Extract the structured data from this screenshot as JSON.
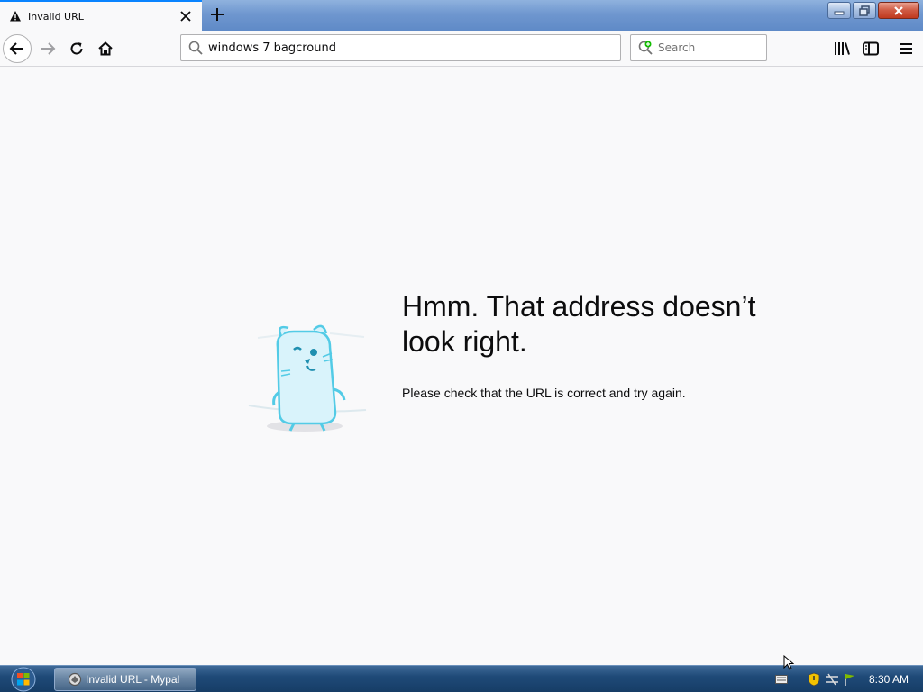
{
  "browser": {
    "tab": {
      "title": "Invalid URL",
      "icon": "warning-icon",
      "close_icon": "close-icon"
    },
    "new_tab_icon": "plus-icon",
    "window_controls": [
      "minimize-icon",
      "restore-icon",
      "close-icon"
    ]
  },
  "navbar": {
    "back_icon": "arrow-left-icon",
    "forward_icon": "arrow-right-icon",
    "reload_icon": "reload-icon",
    "home_icon": "home-icon",
    "url_value": "windows 7 bagcround",
    "search_placeholder": "Search",
    "library_icon": "library-icon",
    "sidebar_icon": "sidebar-icon",
    "menu_icon": "hamburger-menu-icon"
  },
  "error_page": {
    "title": "Hmm. That address doesn’t look right.",
    "description": "Please check that the URL is correct and try again.",
    "illustration": "confused-mascot-illustration"
  },
  "taskbar": {
    "start_icon": "windows-start-icon",
    "task_label": "Invalid URL - Mypal",
    "task_icon": "mypal-app-icon",
    "tray_icons": [
      "keyboard-icon",
      "security-shield-icon",
      "network-icon",
      "flag-icon"
    ],
    "clock": "8:30 AM"
  },
  "colors": {
    "accent": "#0a84ff",
    "page_bg": "#f9f9fa",
    "taskbar": "#1f4a78",
    "titlebar": "#6f97cf"
  }
}
